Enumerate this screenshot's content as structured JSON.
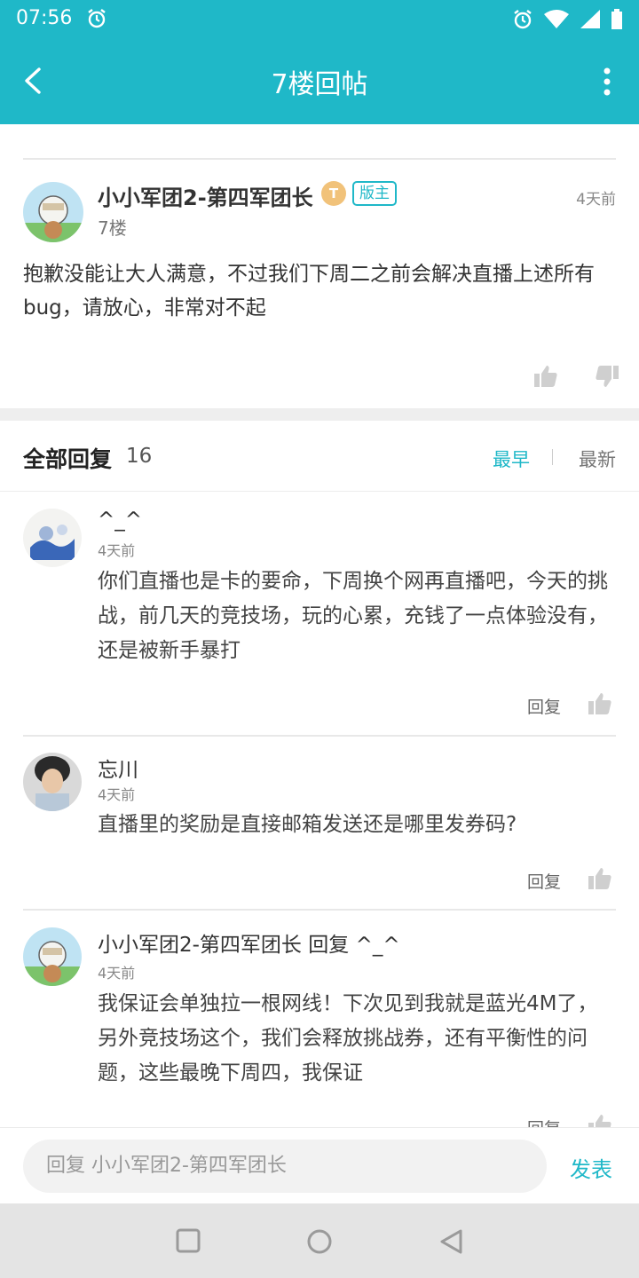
{
  "status_bar": {
    "time": "07:56"
  },
  "app_bar": {
    "title": "7楼回帖"
  },
  "post": {
    "author": "小小军团2-第四军团长",
    "level_badge": "T",
    "role_badge": "版主",
    "time": "4天前",
    "floor": "7楼",
    "content": "抱歉没能让大人满意，不过我们下周二之前会解决直播上述所有bug，请放心，非常对不起"
  },
  "replies_header": {
    "title": "全部回复",
    "count": "16",
    "sort_earliest": "最早",
    "sort_latest": "最新"
  },
  "replies": [
    {
      "name": "^_^",
      "time": "4天前",
      "content": "你们直播也是卡的要命，下周换个网再直播吧，今天的挑战，前几天的竞技场，玩的心累，充钱了一点体验没有，还是被新手暴打",
      "reply_label": "回复"
    },
    {
      "name": "忘川",
      "time": "4天前",
      "content": "直播里的奖励是直接邮箱发送还是哪里发券码?",
      "reply_label": "回复"
    },
    {
      "name": "小小军团2-第四军团长",
      "reply_to_prefix": "回复",
      "reply_to": "^_^",
      "time": "4天前",
      "content": "我保证会单独拉一根网线！下次见到我就是蓝光4M了，另外竞技场这个，我们会释放挑战券，还有平衡性的问题，这些最晚下周四，我保证",
      "reply_label": "回复"
    }
  ],
  "composer": {
    "placeholder": "回复 小小军团2-第四军团长",
    "send_label": "发表"
  },
  "colors": {
    "accent": "#1fb8c8",
    "divider": "#e8e8e8"
  }
}
